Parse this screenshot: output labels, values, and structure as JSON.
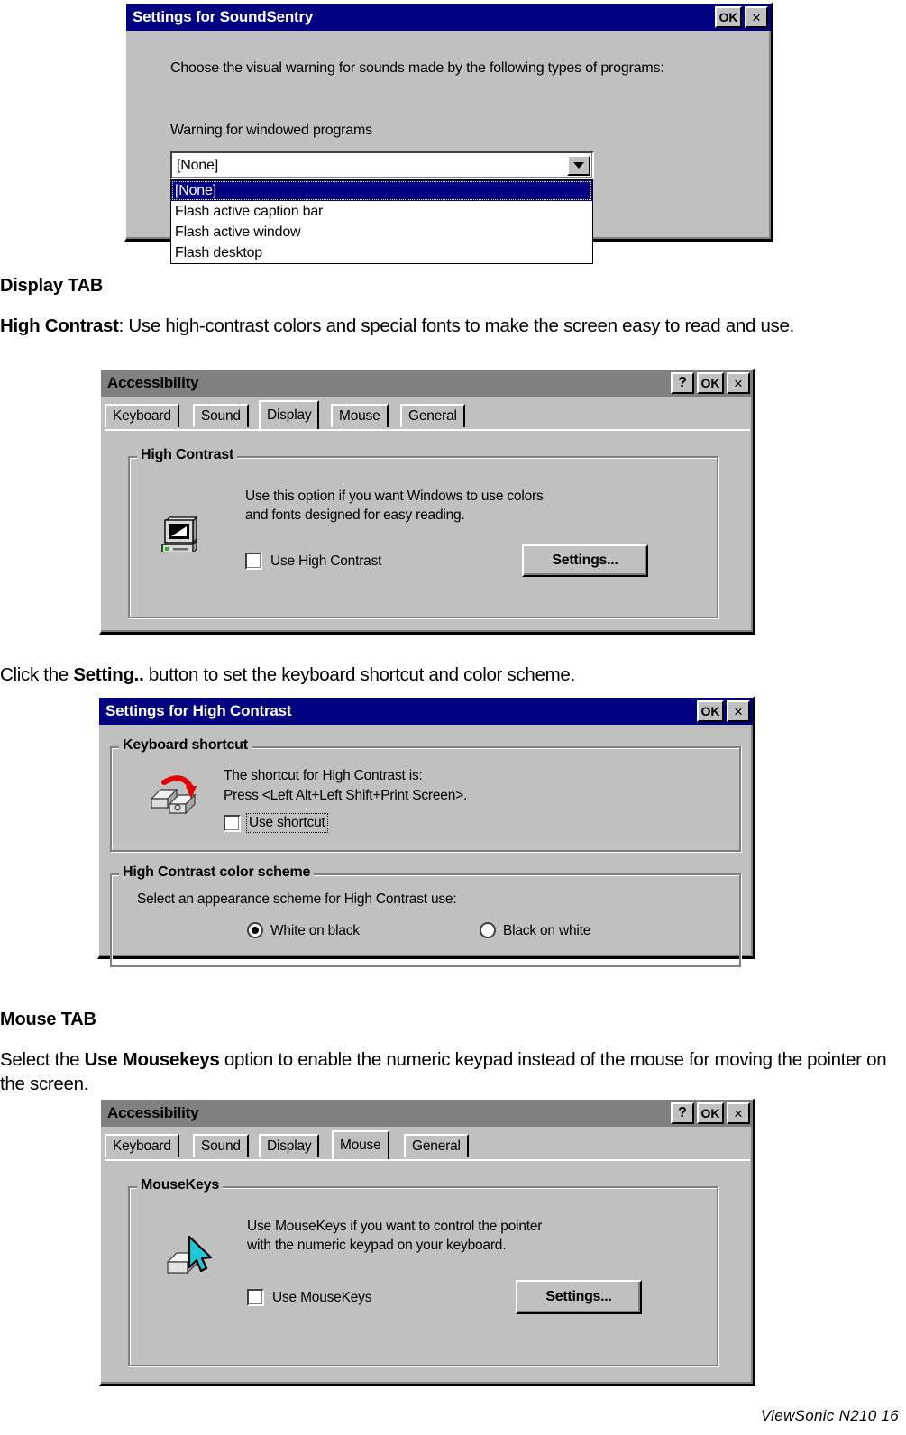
{
  "doc": {
    "heading_display": "Display TAB",
    "para_high_contrast_prefix": "High Contrast",
    "para_high_contrast_rest": ": Use high-contrast colors and special fonts to make the screen easy to read and use.",
    "para_click_setting_pre": "Click the ",
    "para_click_setting_bold": "Setting..",
    "para_click_setting_post": " button to set the keyboard shortcut and color scheme.",
    "heading_mouse": "Mouse TAB",
    "para_mouse_pre": "Select the ",
    "para_mouse_bold": "Use Mousekeys",
    "para_mouse_post": " option to enable the numeric keypad instead of the mouse for moving the pointer on the screen.",
    "footer": "ViewSonic   N210      16"
  },
  "colors": {
    "title_active": "#000080",
    "title_inactive": "#808080",
    "dialog_face": "#c0c0c0",
    "highlight": "#000080",
    "highlight_text": "#ffffff",
    "accent_red": "#e00000",
    "accent_cyan": "#20c8d8"
  },
  "soundsentry_dialog": {
    "title": "Settings for SoundSentry",
    "buttons": {
      "ok": "OK",
      "close": "×"
    },
    "instruction": "Choose the visual warning for sounds made by the following types of programs:",
    "field_label": "Warning for windowed programs",
    "combo": {
      "value": "[None]",
      "options": [
        "[None]",
        "Flash active caption bar",
        "Flash active window",
        "Flash desktop"
      ],
      "selected_index": 0
    }
  },
  "accessibility_display_dialog": {
    "title": "Accessibility",
    "buttons": {
      "help": "?",
      "ok": "OK",
      "close": "×"
    },
    "tabs": [
      {
        "label": "Keyboard",
        "selected": false
      },
      {
        "label": "Sound",
        "selected": false
      },
      {
        "label": "Display",
        "selected": true
      },
      {
        "label": "Mouse",
        "selected": false
      },
      {
        "label": "General",
        "selected": false
      }
    ],
    "group_label": "High Contrast",
    "icon": "monitor-icon",
    "description": "Use this option if you want Windows to use colors\nand fonts designed for easy reading.",
    "checkbox_label": "Use High Contrast",
    "checkbox_checked": false,
    "settings_button": "Settings..."
  },
  "high_contrast_settings_dialog": {
    "title": "Settings for High Contrast",
    "buttons": {
      "ok": "OK",
      "close": "×"
    },
    "keyboard_group": {
      "label": "Keyboard shortcut",
      "icon": "keyboard-shortcut-icon",
      "line1": "The shortcut for High Contrast is:",
      "line2": "Press <Left Alt+Left Shift+Print Screen>.",
      "checkbox_label": "Use shortcut",
      "checkbox_checked": false
    },
    "color_group": {
      "label": "High Contrast color scheme",
      "description": "Select an appearance scheme for High Contrast use:",
      "options": [
        {
          "label": "White on black",
          "selected": true
        },
        {
          "label": "Black on white",
          "selected": false
        }
      ]
    }
  },
  "accessibility_mouse_dialog": {
    "title": "Accessibility",
    "buttons": {
      "help": "?",
      "ok": "OK",
      "close": "×"
    },
    "tabs": [
      {
        "label": "Keyboard",
        "selected": false
      },
      {
        "label": "Sound",
        "selected": false
      },
      {
        "label": "Display",
        "selected": false
      },
      {
        "label": "Mouse",
        "selected": true
      },
      {
        "label": "General",
        "selected": false
      }
    ],
    "group_label": "MouseKeys",
    "icon": "mousekeys-icon",
    "description": "Use MouseKeys if you want to control the pointer\nwith the numeric keypad on your keyboard.",
    "checkbox_label": "Use MouseKeys",
    "checkbox_checked": false,
    "settings_button": "Settings..."
  }
}
